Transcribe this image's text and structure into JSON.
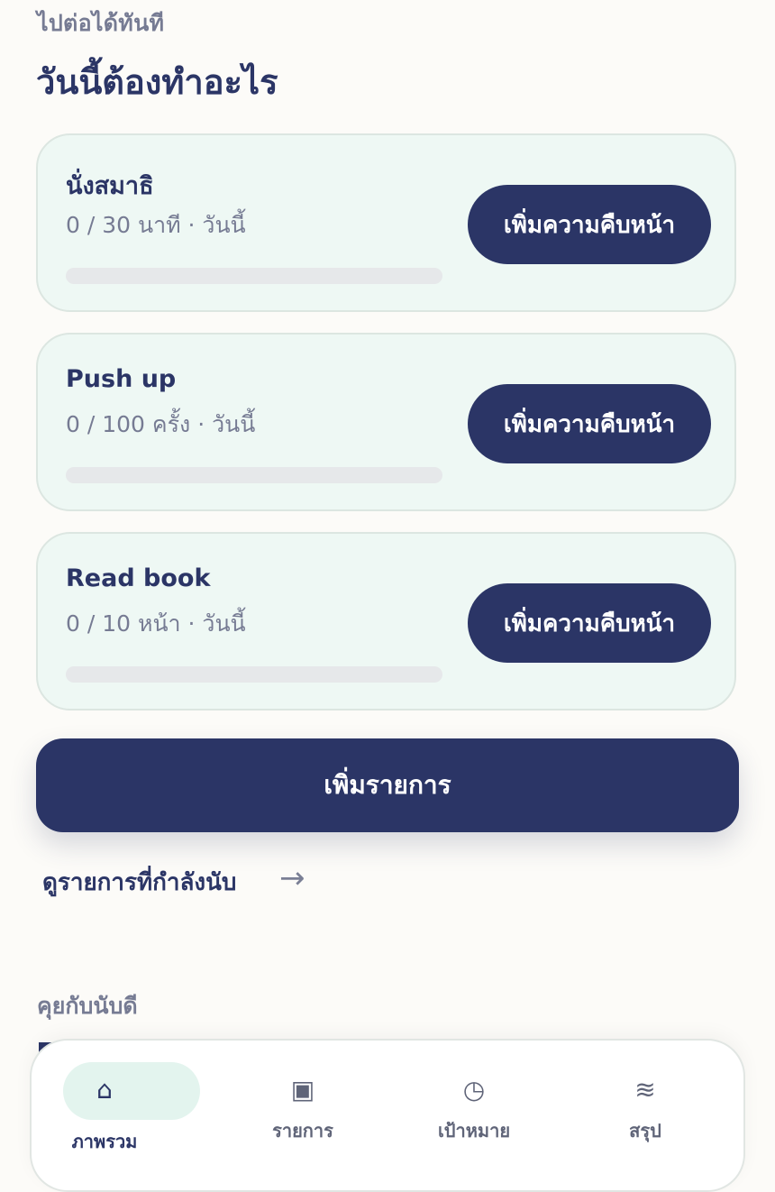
{
  "header": {
    "eyebrow": "ไปต่อได้ทันที",
    "title": "วันนี้ต้องทำอะไร"
  },
  "tasks": [
    {
      "name": "นั่งสมาธิ",
      "meta": "0 / 30 นาที · วันนี้",
      "progress": 0,
      "button_label": "เพิ่มความคืบหน้า"
    },
    {
      "name": "Push up",
      "meta": "0 / 100 ครั้ง · วันนี้",
      "progress": 0,
      "button_label": "เพิ่มความคืบหน้า"
    },
    {
      "name": "Read book",
      "meta": "0 / 10 หน้า · วันนี้",
      "progress": 0,
      "button_label": "เพิ่มความคืบหน้า"
    }
  ],
  "actions": {
    "add_item_label": "เพิ่มรายการ",
    "view_counting_label": "ดูรายการที่กำลังนับ",
    "arrow_icon": "→"
  },
  "sections": {
    "chat_label": "คุยกับนับดี"
  },
  "nav": {
    "items": [
      {
        "label": "ภาพรวม",
        "icon": "⌂",
        "icon_name": "home-icon",
        "active": true
      },
      {
        "label": "รายการ",
        "icon": "▣",
        "icon_name": "list-square-icon",
        "active": false
      },
      {
        "label": "เป้าหมาย",
        "icon": "◷",
        "icon_name": "clock-icon",
        "active": false
      },
      {
        "label": "สรุป",
        "icon": "≋",
        "icon_name": "summary-waves-icon",
        "active": false
      }
    ]
  },
  "colors": {
    "primary": "#2b3566",
    "card_bg": "#eef8f4",
    "page_bg": "#fcfbf8",
    "muted_text": "#767b93",
    "nav_active_bg": "#e3f4ee"
  }
}
